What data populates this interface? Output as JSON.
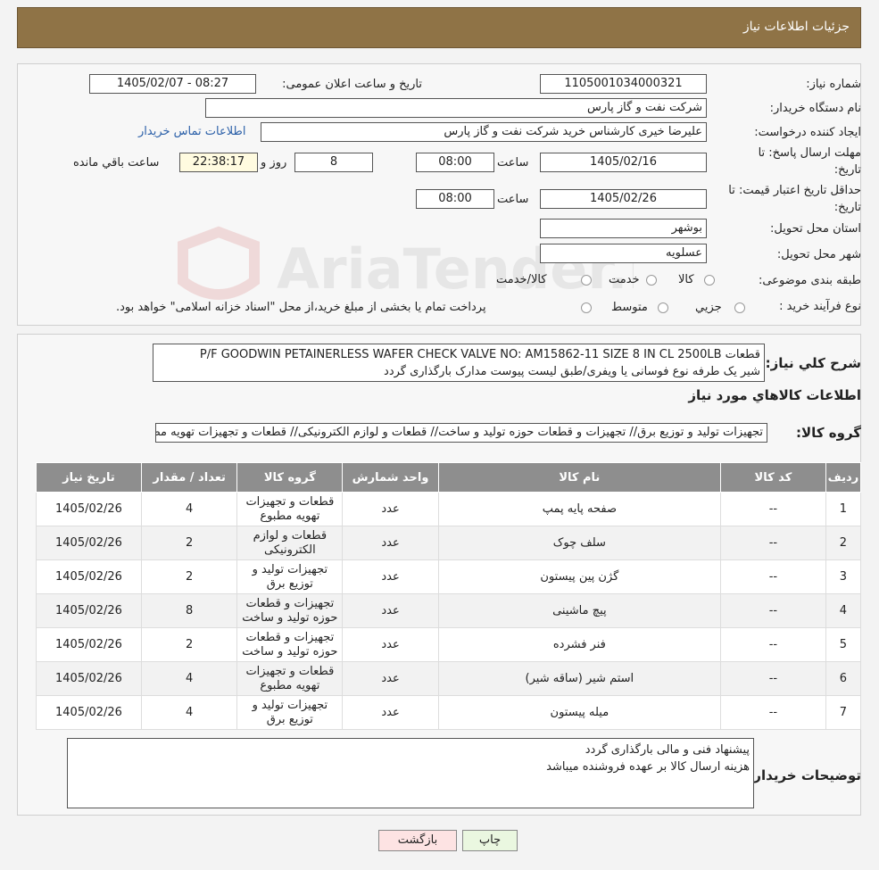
{
  "header": {
    "title": "جزئیات اطلاعات نیاز"
  },
  "info": {
    "need_number_label": "شماره نیاز:",
    "need_number": "1105001034000321",
    "announce_label": "تاریخ و ساعت اعلان عمومی:",
    "announce_value": "1405/02/07 - 08:27",
    "buyer_org_label": "نام دستگاه خریدار:",
    "buyer_org": "شرکت نفت و گاز پارس",
    "creator_label": "ایجاد کننده درخواست:",
    "creator": "علیرضا  خیری کارشناس خرید  شرکت نفت و گاز پارس",
    "contact_link": "اطلاعات تماس خریدار",
    "deadline_label_1": "مهلت ارسال پاسخ: تا",
    "deadline_label_2": "تاریخ:",
    "deadline_date": "1405/02/16",
    "time_label": "ساعت",
    "deadline_time": "08:00",
    "days_value": "8",
    "days_label": "روز و",
    "remaining_time": "22:38:17",
    "remaining_label": "ساعت باقي مانده",
    "validity_label_1": "حداقل تاریخ اعتبار قیمت: تا",
    "validity_label_2": "تاریخ:",
    "validity_date": "1405/02/26",
    "validity_time": "08:00",
    "province_label": "استان محل تحویل:",
    "province": "بوشهر",
    "city_label": "شهر محل تحویل:",
    "city": "عسلویه",
    "category_label": "طبقه بندی موضوعی:",
    "category_options": [
      "کالا",
      "خدمت",
      "کالا/خدمت"
    ],
    "process_label": "نوع فرآیند خرید :",
    "process_options": [
      "جزیي",
      "متوسط"
    ],
    "process_note": "پرداخت تمام یا بخشی از مبلغ خرید،از محل \"اسناد خزانه اسلامی\" خواهد بود."
  },
  "description": {
    "label": "شرح کلي نياز:",
    "line1": "قطعات P/F GOODWIN PETAINERLESS WAFER CHECK VALVE NO: AM15862-11 SIZE 8 IN CL 2500LB",
    "line2": "شیر یک طرفه نوع فوسانی یا ویفری/طبق لیست پیوست مدارک بارگذاری گردد"
  },
  "goods": {
    "section_title": "اطلاعات کالاهاي مورد نياز",
    "group_label": "گروه کالا:",
    "group_value": "تجهیزات تولید و توزیع برق// تجهیزات و قطعات حوزه تولید و ساخت// قطعات و لوازم الکترونیکی//  قطعات و تجهیزات تهویه مطبوع",
    "columns": [
      "رديف",
      "کد کالا",
      "نام کالا",
      "واحد شمارش",
      "گروه کالا",
      "تعداد / مقدار",
      "تاريخ نياز"
    ],
    "rows": [
      {
        "row": "1",
        "code": "--",
        "name": "صفحه پایه پمپ",
        "unit": "عدد",
        "group": "قطعات و تجهیزات تهویه مطبوع",
        "qty": "4",
        "date": "1405/02/26"
      },
      {
        "row": "2",
        "code": "--",
        "name": "سلف چوک",
        "unit": "عدد",
        "group": "قطعات و لوازم الکترونیکی",
        "qty": "2",
        "date": "1405/02/26"
      },
      {
        "row": "3",
        "code": "--",
        "name": "گژن پین پیستون",
        "unit": "عدد",
        "group": "تجهیزات تولید و توزیع برق",
        "qty": "2",
        "date": "1405/02/26"
      },
      {
        "row": "4",
        "code": "--",
        "name": "پیچ ماشینی",
        "unit": "عدد",
        "group": "تجهیزات و قطعات حوزه تولید و ساخت",
        "qty": "8",
        "date": "1405/02/26"
      },
      {
        "row": "5",
        "code": "--",
        "name": "فنر فشرده",
        "unit": "عدد",
        "group": "تجهیزات و قطعات حوزه تولید و ساخت",
        "qty": "2",
        "date": "1405/02/26"
      },
      {
        "row": "6",
        "code": "--",
        "name": "استم شیر (ساقه شیر)",
        "unit": "عدد",
        "group": "قطعات و تجهیزات تهویه مطبوع",
        "qty": "4",
        "date": "1405/02/26"
      },
      {
        "row": "7",
        "code": "--",
        "name": "میله پیستون",
        "unit": "عدد",
        "group": "تجهیزات تولید و توزیع برق",
        "qty": "4",
        "date": "1405/02/26"
      }
    ]
  },
  "buyer_notes": {
    "label": "توضیحات خریدار:",
    "line1": "پیشنهاد فنی و مالی بارگذاری گردد",
    "line2": "هزینه ارسال کالا بر عهده فروشنده میباشد"
  },
  "buttons": {
    "print": "چاپ",
    "back": "بازگشت"
  },
  "watermark": {
    "text": "AriaTender.neT"
  },
  "colors": {
    "header": "#8f7346",
    "table_header": "#8e8e8e",
    "link": "#2a5fa8",
    "print_button": "#eaf7e0",
    "back_button": "#fde3e3"
  }
}
